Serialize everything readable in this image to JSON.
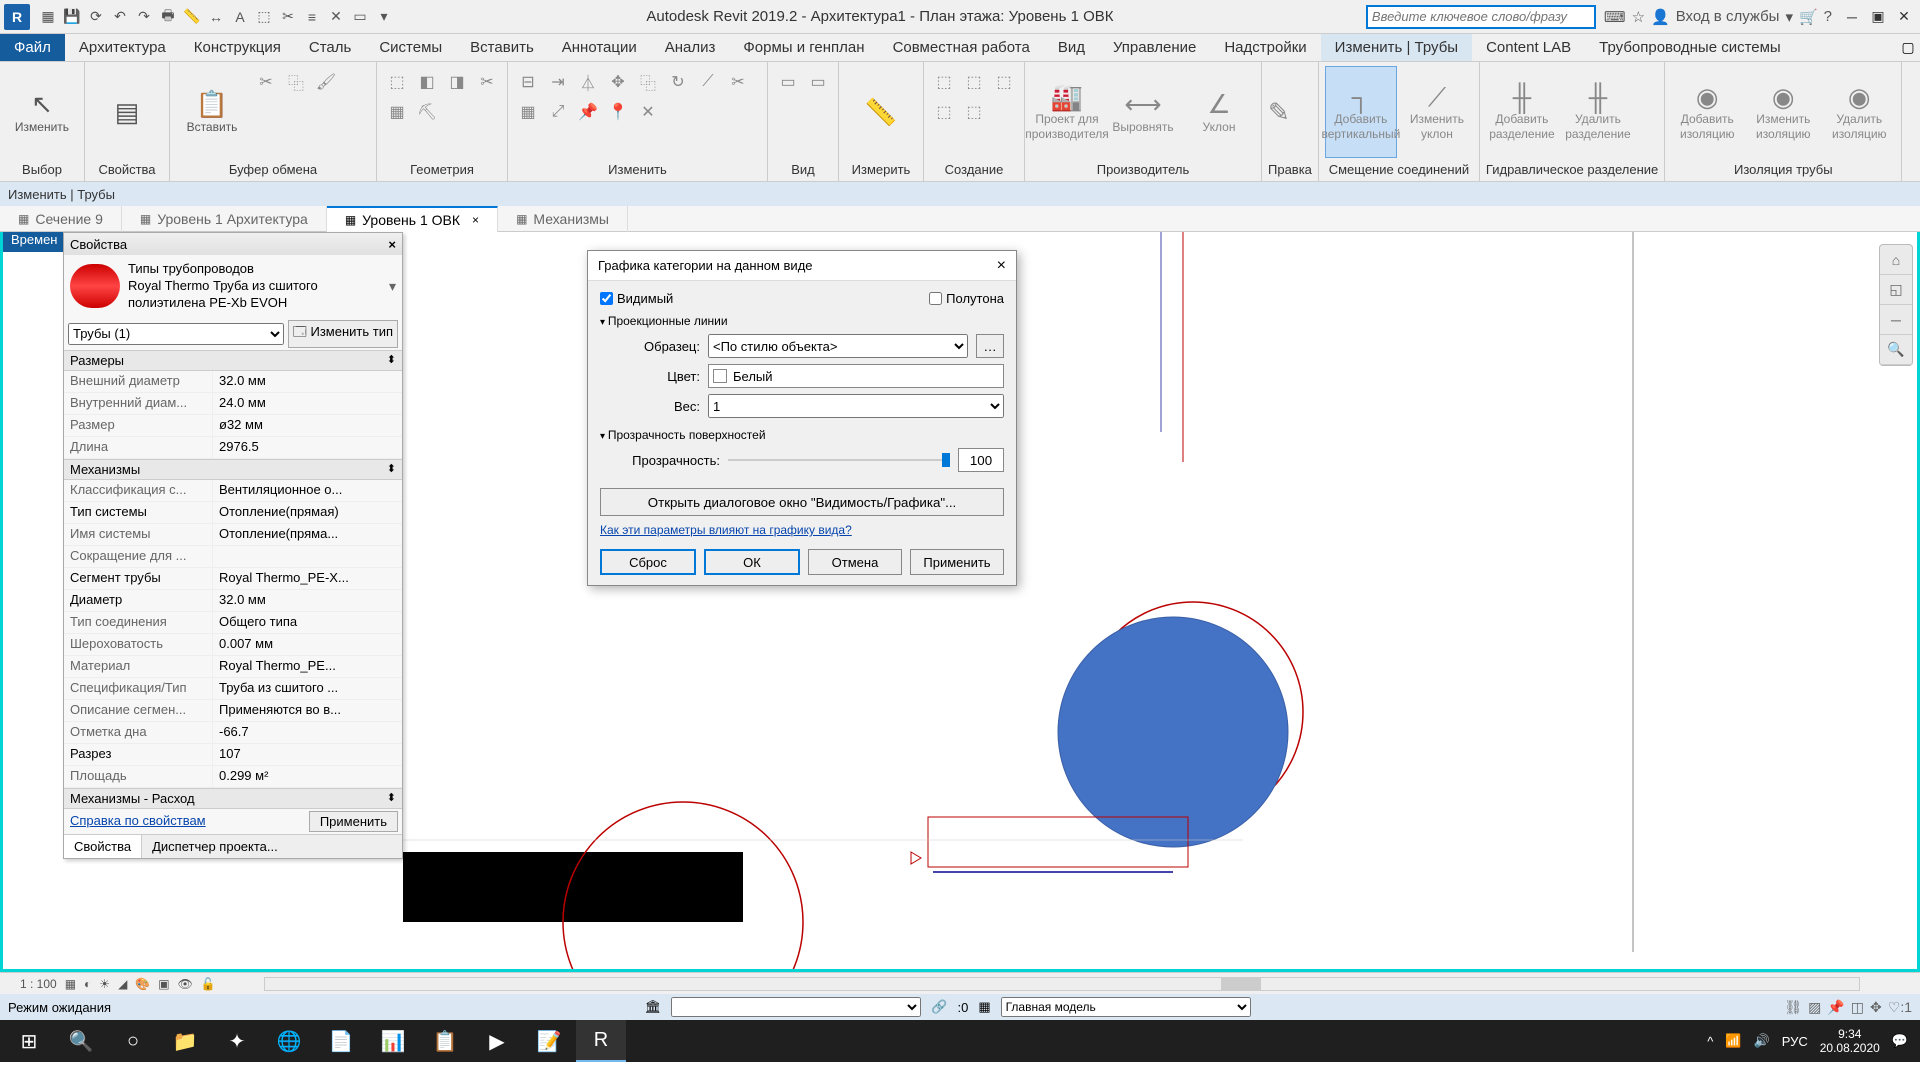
{
  "app": {
    "title": "Autodesk Revit 2019.2 - Архитектура1 - План этажа: Уровень 1 ОВК",
    "search_placeholder": "Введите ключевое слово/фразу",
    "login": "Вход в службы"
  },
  "menu": {
    "file": "Файл",
    "items": [
      "Архитектура",
      "Конструкция",
      "Сталь",
      "Системы",
      "Вставить",
      "Аннотации",
      "Анализ",
      "Формы и генплан",
      "Совместная работа",
      "Вид",
      "Управление",
      "Надстройки",
      "Изменить | Трубы",
      "Content LAB",
      "Трубопроводные системы"
    ],
    "active": "Изменить | Трубы"
  },
  "ribbon": {
    "select_label": "Выбор",
    "select_btn": "Изменить",
    "props_label": "Свойства",
    "props_btn": "",
    "clip_label": "Буфер обмена",
    "clip_btn": "Вставить",
    "geom_label": "Геометрия",
    "modify_label": "Изменить",
    "view_label": "Вид",
    "measure_label": "Измерить",
    "create_label": "Создание",
    "mfr_label": "Производитель",
    "mfr_btn1": "Проект для",
    "mfr_btn1b": "производителя",
    "mfr_btn2": "Выровнять",
    "mfr_btn3": "Уклон",
    "edit_label": "Правка",
    "offset_label": "Смещение соединений",
    "offset_btn1": "Добавить",
    "offset_btn1b": "вертикальный",
    "offset_btn2": "Изменить",
    "offset_btn2b": "уклон",
    "hydro_label": "Гидравлическое разделение",
    "hydro_btn1": "Добавить",
    "hydro_btn1b": "разделение",
    "hydro_btn2": "Удалить",
    "hydro_btn2b": "разделение",
    "iso_label": "Изоляция трубы",
    "iso_btn1": "Добавить",
    "iso_btn1b": "изоляцию",
    "iso_btn2": "Изменить",
    "iso_btn2b": "изоляцию",
    "iso_btn3": "Удалить",
    "iso_btn3b": "изоляцию"
  },
  "subtitle": "Изменить | Трубы",
  "tabs": [
    {
      "label": "Сечение 9",
      "active": false
    },
    {
      "label": "Уровень 1 Архитектура",
      "active": false
    },
    {
      "label": "Уровень 1 ОВК",
      "active": true
    },
    {
      "label": "Механизмы",
      "active": false
    }
  ],
  "vtab": "Времен",
  "props": {
    "title": "Свойства",
    "type_l1": "Типы трубопроводов",
    "type_l2": "Royal Thermo Труба из сшитого полиэтилена PE-Xb EVOH",
    "selector": "Трубы (1)",
    "edit_type": "Изменить тип",
    "g1": "Размеры",
    "rows1": [
      {
        "n": "Внешний диаметр",
        "v": "32.0 мм",
        "e": false
      },
      {
        "n": "Внутренний диам...",
        "v": "24.0 мм",
        "e": false
      },
      {
        "n": "Размер",
        "v": "ø32 мм",
        "e": false
      },
      {
        "n": "Длина",
        "v": "2976.5",
        "e": false
      }
    ],
    "g2": "Механизмы",
    "rows2": [
      {
        "n": "Классификация с...",
        "v": "Вентиляционное о...",
        "e": false
      },
      {
        "n": "Тип системы",
        "v": "Отопление(прямая)",
        "e": true
      },
      {
        "n": "Имя системы",
        "v": "Отопление(пряма...",
        "e": false
      },
      {
        "n": "Сокращение для ...",
        "v": "",
        "e": false
      },
      {
        "n": "Сегмент трубы",
        "v": "Royal Thermo_PE-X...",
        "e": true
      },
      {
        "n": "Диаметр",
        "v": "32.0 мм",
        "e": true
      },
      {
        "n": "Тип соединения",
        "v": "Общего типа",
        "e": false
      },
      {
        "n": "Шероховатость",
        "v": "0.007 мм",
        "e": false
      },
      {
        "n": "Материал",
        "v": "Royal Thermo_PE...",
        "e": false
      },
      {
        "n": "Спецификация/Тип",
        "v": "Труба из сшитого ...",
        "e": false
      },
      {
        "n": "Описание сегмен...",
        "v": "Применяются во в...",
        "e": false
      },
      {
        "n": "Отметка дна",
        "v": "-66.7",
        "e": false
      },
      {
        "n": "Разрез",
        "v": "107",
        "e": true
      },
      {
        "n": "Площадь",
        "v": "0.299 м²",
        "e": false
      }
    ],
    "g3": "Механизмы - Расход",
    "help": "Справка по свойствам",
    "apply": "Применить",
    "tab1": "Свойства",
    "tab2": "Диспетчер проекта..."
  },
  "dialog": {
    "title": "Графика категории на данном виде",
    "visible": "Видимый",
    "halftone": "Полутона",
    "grp1": "Проекционные линии",
    "pattern_l": "Образец:",
    "pattern_v": "<По стилю объекта>",
    "color_l": "Цвет:",
    "color_v": "Белый",
    "weight_l": "Вес:",
    "weight_v": "1",
    "grp2": "Прозрачность поверхностей",
    "trans_l": "Прозрачность:",
    "trans_v": "100",
    "openvg": "Открыть диалоговое окно \"Видимость/Графика\"...",
    "link": "Как эти параметры влияют на графику вида?",
    "reset": "Сброс",
    "ok": "ОК",
    "cancel": "Отмена",
    "apply": "Применить"
  },
  "viewbar": {
    "scale": "1 : 100"
  },
  "status": {
    "mode": "Режим ожидания",
    "zero": ":0",
    "model": "Главная модель",
    "filter": "♡:1",
    "lang": "РУС"
  },
  "tray": {
    "time": "9:34",
    "date": "20.08.2020"
  }
}
